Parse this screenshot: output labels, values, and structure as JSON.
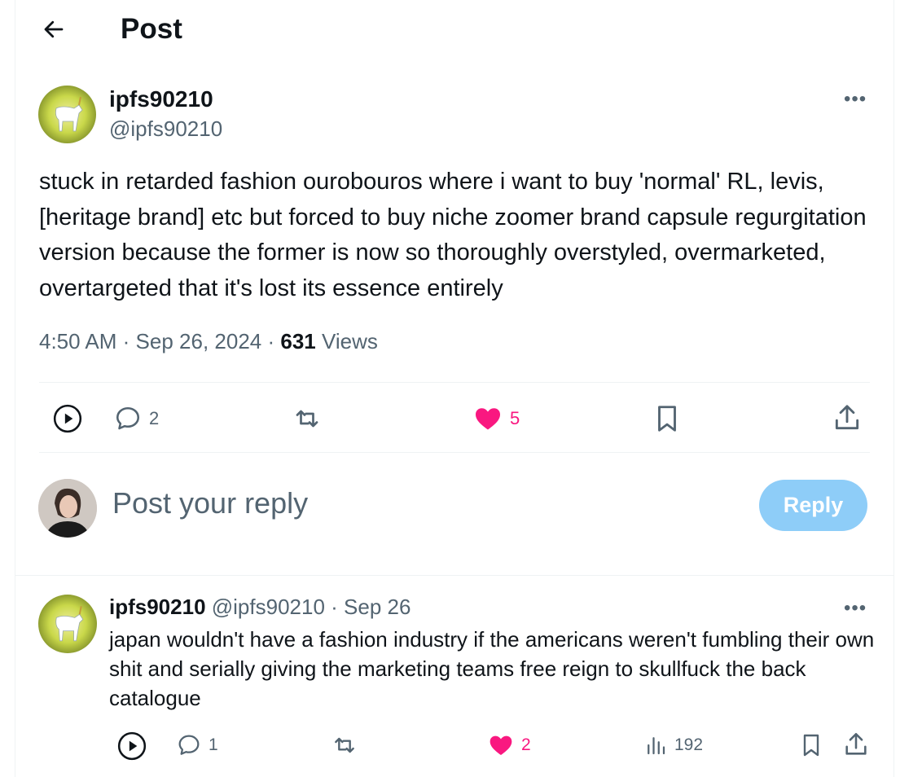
{
  "header": {
    "title": "Post"
  },
  "post": {
    "display_name": "ipfs90210",
    "handle": "@ipfs90210",
    "text": "stuck in retarded fashion ourobouros where i want to buy 'normal' RL, levis, [heritage brand] etc but forced to buy niche zoomer brand capsule regurgitation version because the former is now so thoroughly overstyled, overmarketed, overtargeted that it's lost its essence entirely",
    "time": "4:50 AM",
    "date": "Sep 26, 2024",
    "separator": "·",
    "views_count": "631",
    "views_label": "Views",
    "replies": "2",
    "likes": "5"
  },
  "compose": {
    "placeholder": "Post your reply",
    "button_label": "Reply"
  },
  "reply": {
    "display_name": "ipfs90210",
    "handle": "@ipfs90210",
    "date": "· Sep 26",
    "text": "japan wouldn't have a fashion industry if the americans weren't fumbling their own shit and serially giving the marketing teams free reign to skullfuck the back catalogue",
    "replies": "1",
    "likes": "2",
    "views": "192"
  },
  "colors": {
    "accent": "#1d9bf0",
    "like": "#f91880",
    "muted": "#536471",
    "reply_button": "#8ecdf8"
  },
  "icons": [
    "back-arrow-icon",
    "more-icon",
    "play-icon",
    "reply-icon",
    "retweet-icon",
    "heart-icon",
    "bookmark-icon",
    "share-icon",
    "views-icon"
  ]
}
